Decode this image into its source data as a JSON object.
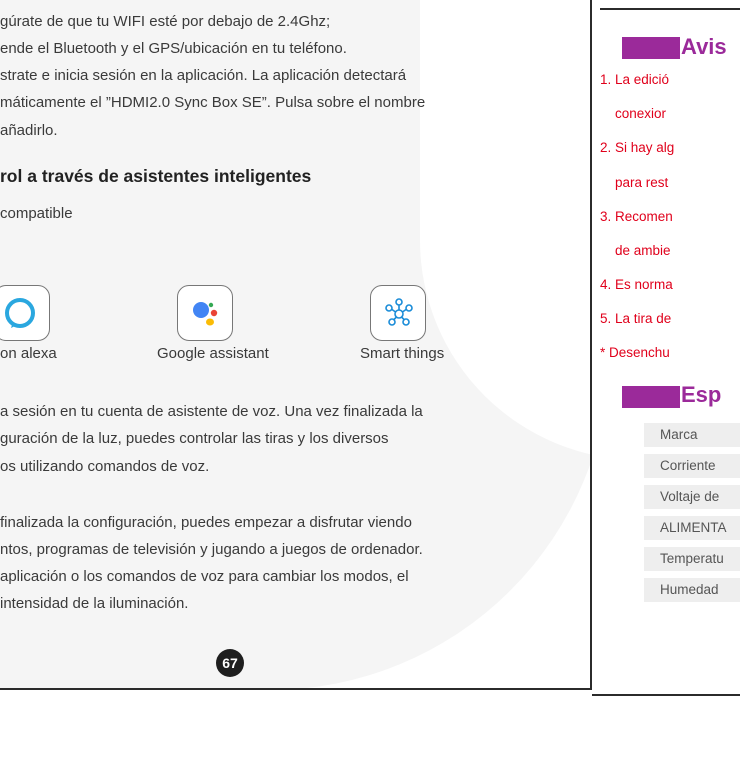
{
  "left": {
    "intro_lines": [
      "gúrate de que tu WIFI esté por debajo de 2.4Ghz;",
      "ende el Bluetooth y el GPS/ubicación en tu teléfono.",
      "strate e inicia sesión en la aplicación. La aplicación detectará",
      "máticamente el ”HDMI2.0 Sync Box SE”. Pulsa sobre el nombre",
      "añadirlo."
    ],
    "section_title": "rol a través de asistentes inteligentes",
    "compatible_label": "compatible",
    "assistants": [
      {
        "label": "on alexa",
        "icon": "alexa-icon"
      },
      {
        "label": "Google assistant",
        "icon": "google-assistant-icon"
      },
      {
        "label": "Smart things",
        "icon": "smartthings-icon"
      }
    ],
    "paragraph1": [
      "a sesión en tu cuenta de asistente de voz. Una vez finalizada la",
      "guración de la luz, puedes controlar las tiras y los diversos",
      "os utilizando comandos de voz."
    ],
    "paragraph2": [
      "finalizada la configuración, puedes empezar a disfrutar viendo",
      "ntos, programas de televisión y jugando a juegos de ordenador.",
      "aplicación o los comandos de voz para cambiar los modos, el",
      "intensidad de la iluminación."
    ],
    "page_number": "67"
  },
  "right": {
    "notice_title": "Avis",
    "notices": [
      "1. La edició",
      "conexior",
      "2. Si hay alg",
      "para rest",
      "3. Recomen",
      "de ambie",
      "4. Es norma",
      "5. La tira de",
      "* Desenchu"
    ],
    "spec_title": "Esp",
    "spec_rows": [
      "Marca",
      "Corriente",
      "Voltaje de",
      "ALIMENTA",
      "Temperatu",
      "Humedad"
    ],
    "accent_color": "#9b2a9a",
    "notice_color": "#e0001b"
  }
}
